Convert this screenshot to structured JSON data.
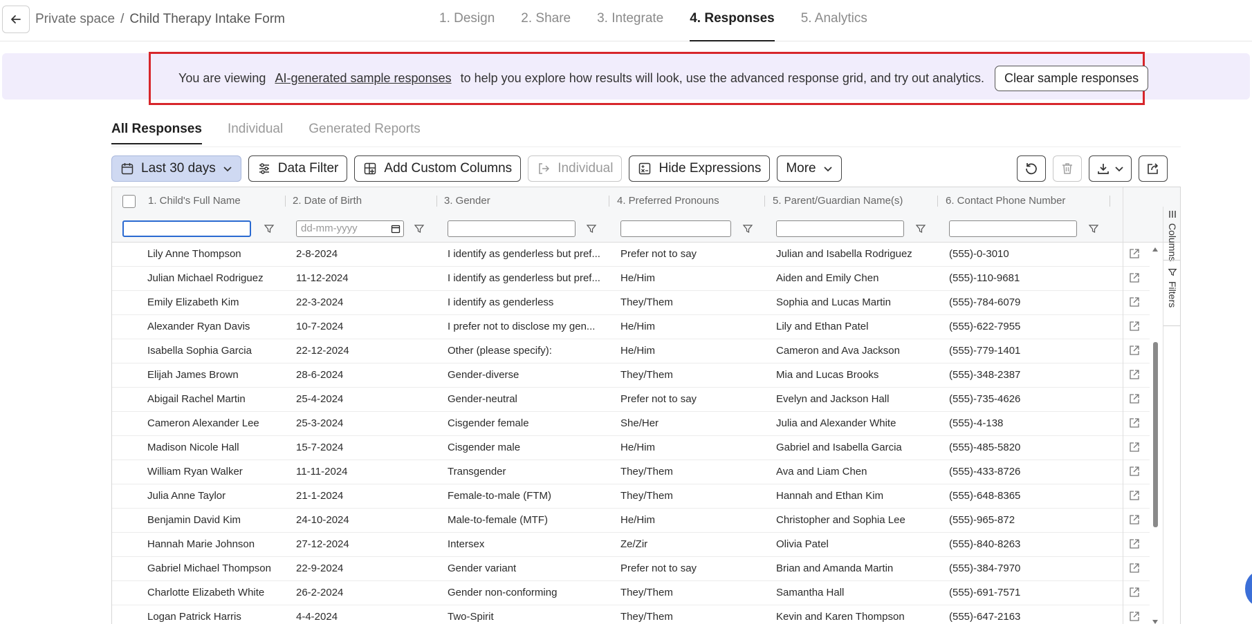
{
  "header": {
    "breadcrumb_space": "Private space",
    "breadcrumb_sep": "/",
    "breadcrumb_form": "Child Therapy Intake Form",
    "steps": [
      "1. Design",
      "2. Share",
      "3. Integrate",
      "4. Responses",
      "5. Analytics"
    ],
    "active_step": "4. Responses"
  },
  "banner": {
    "text_before": "You are viewing",
    "link_text": "AI-generated sample responses",
    "text_after": "to help you explore how results will look, use the advanced response grid, and try out analytics.",
    "clear_label": "Clear sample responses"
  },
  "subtabs": [
    "All Responses",
    "Individual",
    "Generated Reports"
  ],
  "toolbar": {
    "date_range": "Last 30 days",
    "data_filter": "Data Filter",
    "add_columns": "Add Custom Columns",
    "individual": "Individual",
    "hide_expressions": "Hide Expressions",
    "more": "More"
  },
  "grid": {
    "columns": [
      "1. Child's Full Name",
      "2. Date of Birth",
      "3. Gender",
      "4. Preferred Pronouns",
      "5. Parent/Guardian Name(s)",
      "6. Contact Phone Number"
    ],
    "date_placeholder": "dd-mm-yyyy",
    "side_columns": "Columns",
    "side_filters": "Filters",
    "rows": [
      [
        "Lily Anne Thompson",
        "2-8-2024",
        "I identify as genderless but pref...",
        "Prefer not to say",
        "Julian and Isabella Rodriguez",
        "(555)-0-3010"
      ],
      [
        "Julian Michael Rodriguez",
        "11-12-2024",
        "I identify as genderless but pref...",
        "He/Him",
        "Aiden and Emily Chen",
        "(555)-110-9681"
      ],
      [
        "Emily Elizabeth Kim",
        "22-3-2024",
        "I identify as genderless",
        "They/Them",
        "Sophia and Lucas Martin",
        "(555)-784-6079"
      ],
      [
        "Alexander Ryan Davis",
        "10-7-2024",
        "I prefer not to disclose my gen...",
        "He/Him",
        "Lily and Ethan Patel",
        "(555)-622-7955"
      ],
      [
        "Isabella Sophia Garcia",
        "22-12-2024",
        "Other (please specify):",
        "He/Him",
        "Cameron and Ava Jackson",
        "(555)-779-1401"
      ],
      [
        "Elijah James Brown",
        "28-6-2024",
        "Gender-diverse",
        "They/Them",
        "Mia and Lucas Brooks",
        "(555)-348-2387"
      ],
      [
        "Abigail Rachel Martin",
        "25-4-2024",
        "Gender-neutral",
        "Prefer not to say",
        "Evelyn and Jackson Hall",
        "(555)-735-4626"
      ],
      [
        "Cameron Alexander Lee",
        "25-3-2024",
        "Cisgender female",
        "She/Her",
        "Julia and Alexander White",
        "(555)-4-138"
      ],
      [
        "Madison Nicole Hall",
        "15-7-2024",
        "Cisgender male",
        "He/Him",
        "Gabriel and Isabella Garcia",
        "(555)-485-5820"
      ],
      [
        "William Ryan Walker",
        "11-11-2024",
        "Transgender",
        "They/Them",
        "Ava and Liam Chen",
        "(555)-433-8726"
      ],
      [
        "Julia Anne Taylor",
        "21-1-2024",
        "Female-to-male (FTM)",
        "They/Them",
        "Hannah and Ethan Kim",
        "(555)-648-8365"
      ],
      [
        "Benjamin David Kim",
        "24-10-2024",
        "Male-to-female (MTF)",
        "He/Him",
        "Christopher and Sophia Lee",
        "(555)-965-872"
      ],
      [
        "Hannah Marie Johnson",
        "27-12-2024",
        "Intersex",
        "Ze/Zir",
        "Olivia Patel",
        "(555)-840-8263"
      ],
      [
        "Gabriel Michael Thompson",
        "22-9-2024",
        "Gender variant",
        "Prefer not to say",
        "Brian and Amanda Martin",
        "(555)-384-7970"
      ],
      [
        "Charlotte Elizabeth White",
        "26-2-2024",
        "Gender non-conforming",
        "They/Them",
        "Samantha Hall",
        "(555)-691-7571"
      ],
      [
        "Logan Patrick Harris",
        "4-4-2024",
        "Two-Spirit",
        "They/Them",
        "Kevin and Karen Thompson",
        "(555)-647-2163"
      ]
    ]
  }
}
